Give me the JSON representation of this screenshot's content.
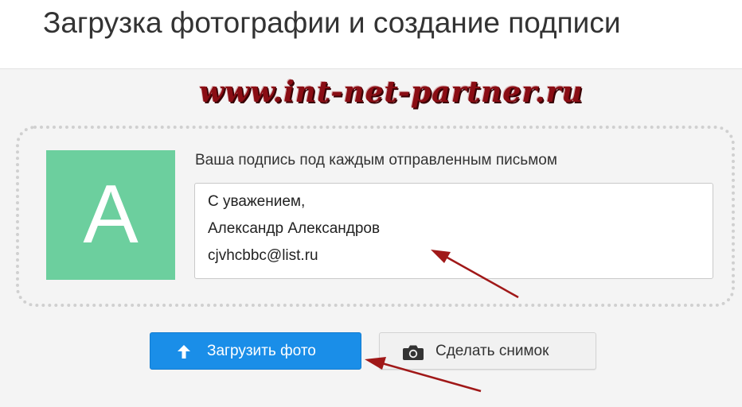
{
  "header": {
    "title": "Загрузка фотографии и создание подписи"
  },
  "watermark": {
    "text": "www.int-net-partner.ru"
  },
  "avatar": {
    "letter": "A",
    "background_color": "#6ccf9e"
  },
  "signature": {
    "label": "Ваша подпись под каждым отправленным письмом",
    "lines": [
      "С уважением,",
      "Александр Александров",
      "cjvhcbbc@list.ru"
    ]
  },
  "buttons": {
    "upload": {
      "label": "Загрузить фото",
      "icon": "upload-arrow-icon",
      "color": "#1a8ee8"
    },
    "snapshot": {
      "label": "Сделать снимок",
      "icon": "camera-icon"
    }
  },
  "annotations": {
    "arrow_color": "#a01818"
  }
}
